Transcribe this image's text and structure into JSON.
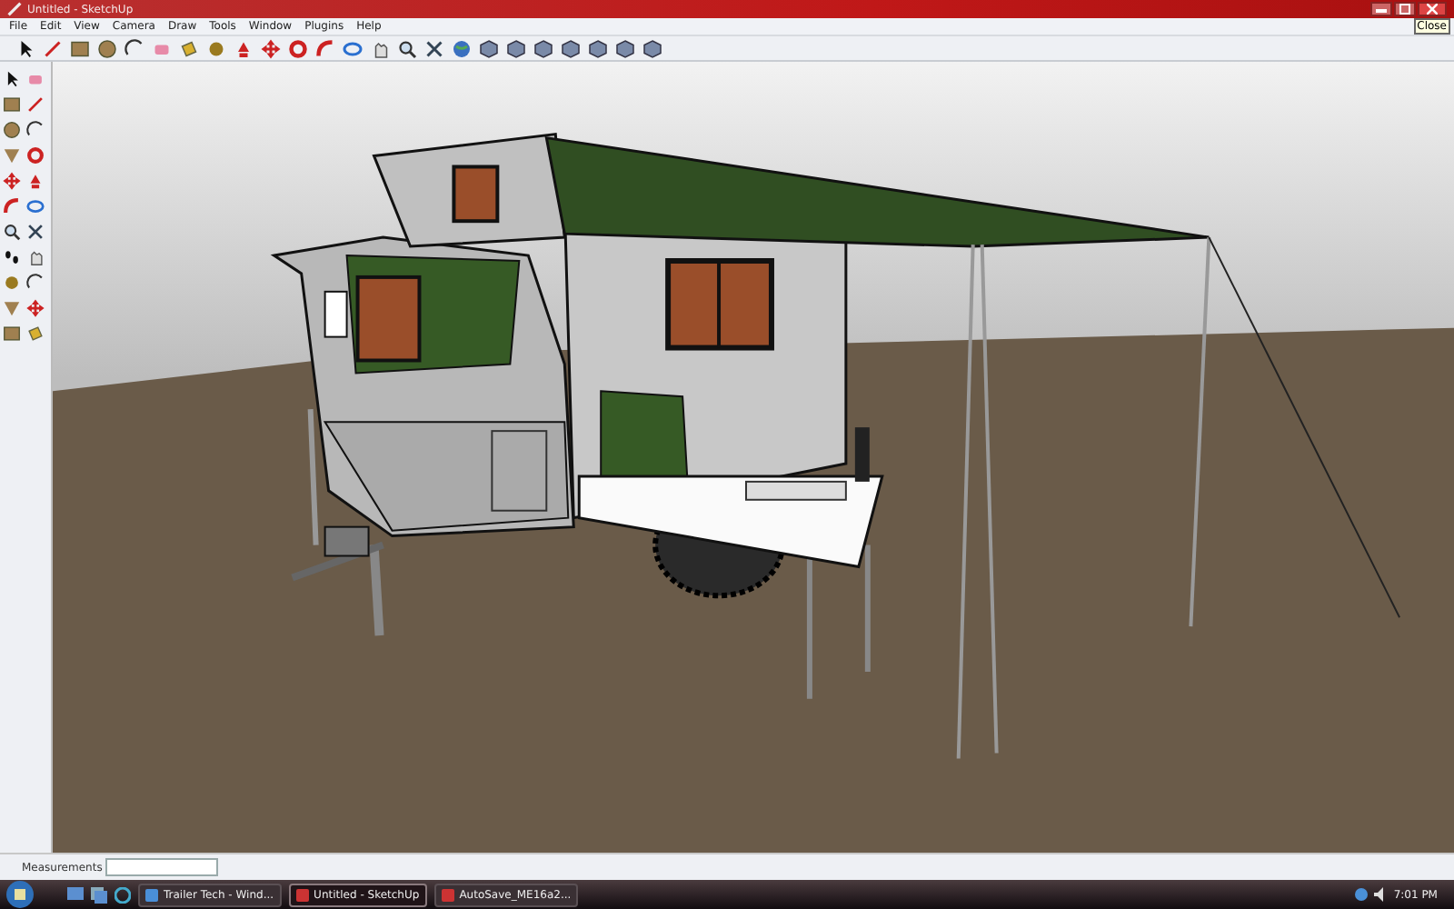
{
  "window": {
    "title": "Untitled - SketchUp",
    "tooltip": "Close"
  },
  "menu": [
    "File",
    "Edit",
    "View",
    "Camera",
    "Draw",
    "Tools",
    "Window",
    "Plugins",
    "Help"
  ],
  "status_bar": {
    "measurements_label": "Measurements"
  },
  "taskbar": {
    "buttons": [
      {
        "label": "Trailer Tech - Wind...",
        "selected": false
      },
      {
        "label": "Untitled - SketchUp",
        "selected": true
      },
      {
        "label": "AutoSave_ME16a2...",
        "selected": false
      }
    ],
    "clock": "7:01 PM"
  }
}
